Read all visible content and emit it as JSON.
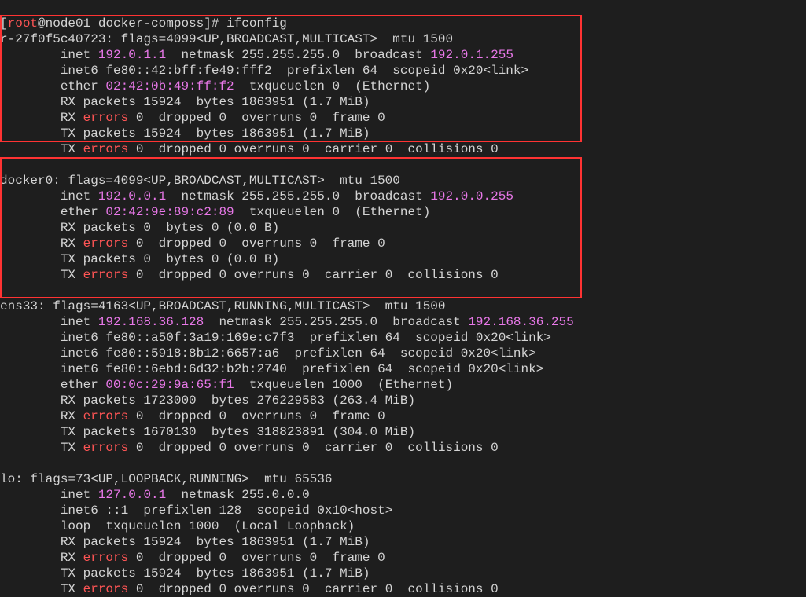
{
  "prompt": {
    "open": "[",
    "user": "root",
    "at": "@",
    "host": "node01",
    "space": " ",
    "path": "docker-composs",
    "close": "]# ",
    "command": "ifconfig"
  },
  "interfaces": {
    "br": {
      "name": "r-27f0f5c40723:",
      "flags": " flags=4099<UP,BROADCAST,MULTICAST>  mtu 1500",
      "inet_pre": "        inet ",
      "inet": "192.0.1.1",
      "inet_mid": "  netmask 255.255.255.0  broadcast ",
      "broadcast": "192.0.1.255",
      "inet6": "        inet6 fe80::42:bff:fe49:fff2  prefixlen 64  scopeid 0x20<link>",
      "ether_pre": "        ether ",
      "ether": "02:42:0b:49:ff:f2",
      "ether_post": "  txqueuelen 0  (Ethernet)",
      "rx_packets": "        RX packets 15924  bytes 1863951 (1.7 MiB)",
      "rx_err_pre": "        RX ",
      "rx_err": "errors",
      "rx_err_post": " 0  dropped 0  overruns 0  frame 0",
      "tx_packets": "        TX packets 15924  bytes 1863951 (1.7 MiB)",
      "tx_err_pre": "        TX ",
      "tx_err": "errors",
      "tx_err_post": " 0  dropped 0 overruns 0  carrier 0  collisions 0"
    },
    "docker0": {
      "name": "docker0:",
      "flags": " flags=4099<UP,BROADCAST,MULTICAST>  mtu 1500",
      "inet_pre": "        inet ",
      "inet": "192.0.0.1",
      "inet_mid": "  netmask 255.255.255.0  broadcast ",
      "broadcast": "192.0.0.255",
      "ether_pre": "        ether ",
      "ether": "02:42:9e:89:c2:89",
      "ether_post": "  txqueuelen 0  (Ethernet)",
      "rx_packets": "        RX packets 0  bytes 0 (0.0 B)",
      "rx_err_pre": "        RX ",
      "rx_err": "errors",
      "rx_err_post": " 0  dropped 0  overruns 0  frame 0",
      "tx_packets": "        TX packets 0  bytes 0 (0.0 B)",
      "tx_err_pre": "        TX ",
      "tx_err": "errors",
      "tx_err_post": " 0  dropped 0 overruns 0  carrier 0  collisions 0"
    },
    "ens33": {
      "name": "ens33:",
      "flags": " flags=4163<UP,BROADCAST,RUNNING,MULTICAST>  mtu 1500",
      "inet_pre": "        inet ",
      "inet": "192.168.36.128",
      "inet_mid": "  netmask 255.255.255.0  broadcast ",
      "broadcast": "192.168.36.255",
      "inet6a": "        inet6 fe80::a50f:3a19:169e:c7f3  prefixlen 64  scopeid 0x20<link>",
      "inet6b": "        inet6 fe80::5918:8b12:6657:a6  prefixlen 64  scopeid 0x20<link>",
      "inet6c": "        inet6 fe80::6ebd:6d32:b2b:2740  prefixlen 64  scopeid 0x20<link>",
      "ether_pre": "        ether ",
      "ether": "00:0c:29:9a:65:f1",
      "ether_post": "  txqueuelen 1000  (Ethernet)",
      "rx_packets": "        RX packets 1723000  bytes 276229583 (263.4 MiB)",
      "rx_err_pre": "        RX ",
      "rx_err": "errors",
      "rx_err_post": " 0  dropped 0  overruns 0  frame 0",
      "tx_packets": "        TX packets 1670130  bytes 318823891 (304.0 MiB)",
      "tx_err_pre": "        TX ",
      "tx_err": "errors",
      "tx_err_post": " 0  dropped 0 overruns 0  carrier 0  collisions 0"
    },
    "lo": {
      "name": "lo:",
      "flags": " flags=73<UP,LOOPBACK,RUNNING>  mtu 65536",
      "inet_pre": "        inet ",
      "inet": "127.0.0.1",
      "inet_post": "  netmask 255.0.0.0",
      "inet6": "        inet6 ::1  prefixlen 128  scopeid 0x10<host>",
      "loop": "        loop  txqueuelen 1000  (Local Loopback)",
      "rx_packets": "        RX packets 15924  bytes 1863951 (1.7 MiB)",
      "rx_err_pre": "        RX ",
      "rx_err": "errors",
      "rx_err_post": " 0  dropped 0  overruns 0  frame 0",
      "tx_packets": "        TX packets 15924  bytes 1863951 (1.7 MiB)",
      "tx_err_pre": "        TX ",
      "tx_err": "errors",
      "tx_err_post": " 0  dropped 0 overruns 0  carrier 0  collisions 0"
    }
  }
}
